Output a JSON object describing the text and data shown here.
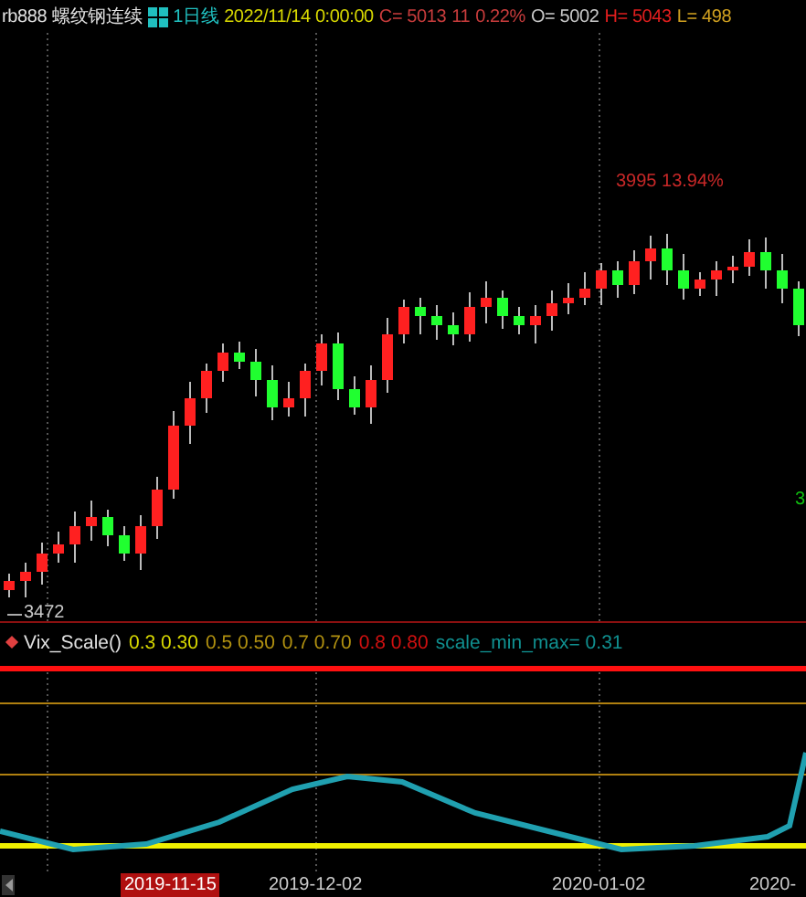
{
  "header": {
    "symbol": "rb888",
    "name": "螺纹钢连续",
    "period": "1日线",
    "datetime": "2022/11/14 0:00:00",
    "quotes": [
      {
        "text": "C= 5013",
        "color": "#c83c3c"
      },
      {
        "text": "11",
        "color": "#c83c3c"
      },
      {
        "text": "0.22%",
        "color": "#c83c3c"
      },
      {
        "text": "O= 5002",
        "color": "#c8c8c8"
      },
      {
        "text": "H= 5043",
        "color": "#e01e1e"
      },
      {
        "text": "L= 498",
        "color": "#d0a020"
      }
    ]
  },
  "chart": {
    "annotations": [
      {
        "text": "3995 13.94%",
        "kind": "high"
      },
      {
        "text": "3472",
        "kind": "low"
      },
      {
        "text": "3",
        "kind": "edge"
      }
    ]
  },
  "indicator": {
    "name": "Vix_Scale()",
    "params": [
      {
        "text": "0.3 0.30",
        "color": "#d8d800"
      },
      {
        "text": "0.5 0.50",
        "color": "#b09010"
      },
      {
        "text": "0.7 0.70",
        "color": "#b09010"
      },
      {
        "text": "0.8 0.80",
        "color": "#d01010"
      },
      {
        "text": "scale_min_max= 0.31",
        "color": "#109090"
      }
    ]
  },
  "axis": {
    "dates": [
      {
        "text": "2019-11-15",
        "selected": true
      },
      {
        "text": "2019-12-02",
        "selected": false
      },
      {
        "text": "2020-01-02",
        "selected": false
      },
      {
        "text": "2020-",
        "selected": false
      }
    ]
  }
}
